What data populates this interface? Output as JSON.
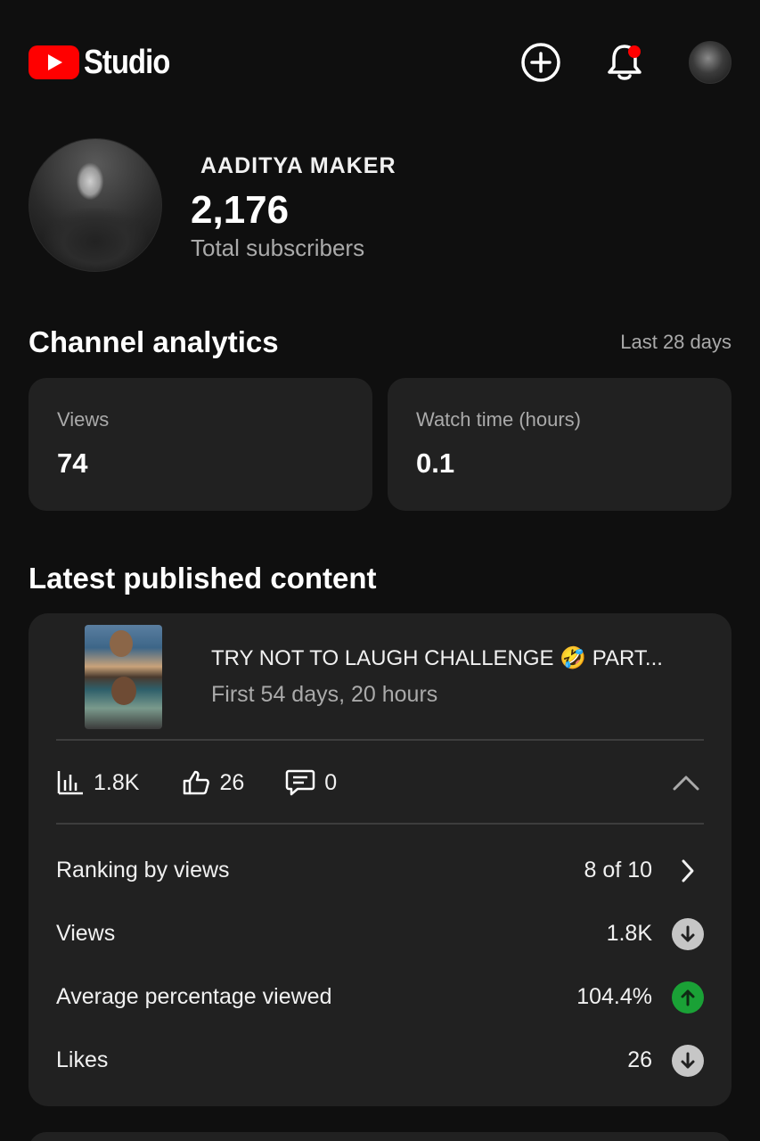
{
  "header": {
    "logo_text": "Studio",
    "icons": [
      "youtube-logo-icon",
      "create-plus-icon",
      "bell-icon",
      "account-avatar"
    ],
    "brand_color": "#ff0000"
  },
  "channel": {
    "name": "AADITYA MAKER",
    "subscribers": "2,176",
    "subscribers_label": "Total subscribers"
  },
  "analytics": {
    "title": "Channel analytics",
    "period": "Last 28 days",
    "metrics": [
      {
        "label": "Views",
        "value": "74"
      },
      {
        "label": "Watch time (hours)",
        "value": "0.1"
      }
    ]
  },
  "latest": {
    "title": "Latest published content",
    "video": {
      "title": "TRY NOT TO LAUGH CHALLENGE 🤣 PART...",
      "subtitle": "First 54 days, 20 hours",
      "views": "1.8K",
      "likes": "26",
      "comments": "0"
    },
    "rows": [
      {
        "label": "Ranking by views",
        "value": "8 of 10",
        "indicator": "chevron-right"
      },
      {
        "label": "Views",
        "value": "1.8K",
        "indicator": "trend-down"
      },
      {
        "label": "Average percentage viewed",
        "value": "104.4%",
        "indicator": "trend-up"
      },
      {
        "label": "Likes",
        "value": "26",
        "indicator": "trend-down"
      }
    ],
    "trend_colors": {
      "up": "#1aa136",
      "down": "#c6c6c6"
    }
  }
}
